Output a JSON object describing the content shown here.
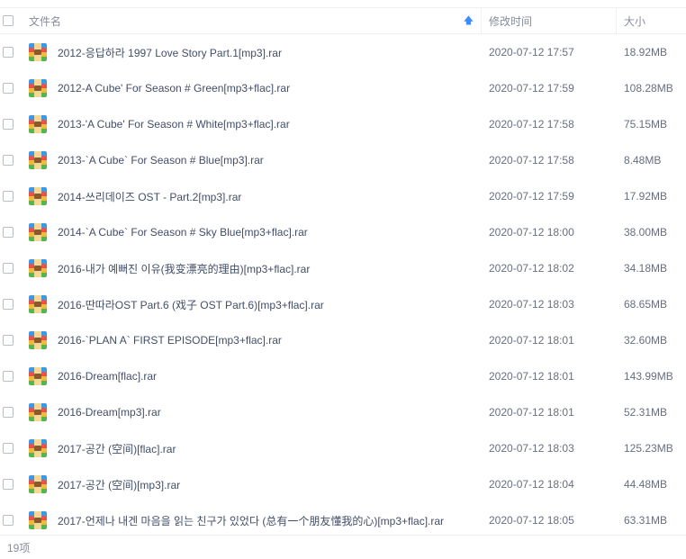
{
  "header": {
    "name_label": "文件名",
    "time_label": "修改时间",
    "size_label": "大小",
    "sort_icon": "arrow-up-icon"
  },
  "files": [
    {
      "name": "2012-응답하라 1997 Love Story Part.1[mp3].rar",
      "time": "2020-07-12 17:57",
      "size": "18.92MB"
    },
    {
      "name": "2012-A Cube' For Season # Green[mp3+flac].rar",
      "time": "2020-07-12 17:59",
      "size": "108.28MB"
    },
    {
      "name": "2013-'A Cube' For Season # White[mp3+flac].rar",
      "time": "2020-07-12 17:58",
      "size": "75.15MB"
    },
    {
      "name": "2013-`A Cube` For Season # Blue[mp3].rar",
      "time": "2020-07-12 17:58",
      "size": "8.48MB"
    },
    {
      "name": "2014-쓰리데이즈 OST - Part.2[mp3].rar",
      "time": "2020-07-12 17:59",
      "size": "17.92MB"
    },
    {
      "name": "2014-`A Cube` For Season # Sky Blue[mp3+flac].rar",
      "time": "2020-07-12 18:00",
      "size": "38.00MB"
    },
    {
      "name": "2016-내가 예뻐진 이유(我变漂亮的理由)[mp3+flac].rar",
      "time": "2020-07-12 18:02",
      "size": "34.18MB"
    },
    {
      "name": "2016-딴따라OST Part.6 (戏子 OST Part.6)[mp3+flac].rar",
      "time": "2020-07-12 18:03",
      "size": "68.65MB"
    },
    {
      "name": "2016-`PLAN A` FIRST EPISODE[mp3+flac].rar",
      "time": "2020-07-12 18:01",
      "size": "32.60MB"
    },
    {
      "name": "2016-Dream[flac].rar",
      "time": "2020-07-12 18:01",
      "size": "143.99MB"
    },
    {
      "name": "2016-Dream[mp3].rar",
      "time": "2020-07-12 18:01",
      "size": "52.31MB"
    },
    {
      "name": "2017-공간 (空间)[flac].rar",
      "time": "2020-07-12 18:03",
      "size": "125.23MB"
    },
    {
      "name": "2017-공간 (空间)[mp3].rar",
      "time": "2020-07-12 18:04",
      "size": "44.48MB"
    },
    {
      "name": "2017-언제나 내겐 마음을 읽는 친구가 있었다 (总有一个朋友懂我的心)[mp3+flac].rar",
      "time": "2020-07-12 18:05",
      "size": "63.31MB"
    }
  ],
  "footer": {
    "count_label": "19项"
  },
  "colors": {
    "accent": "#3b8cff",
    "text": "#424e67"
  }
}
